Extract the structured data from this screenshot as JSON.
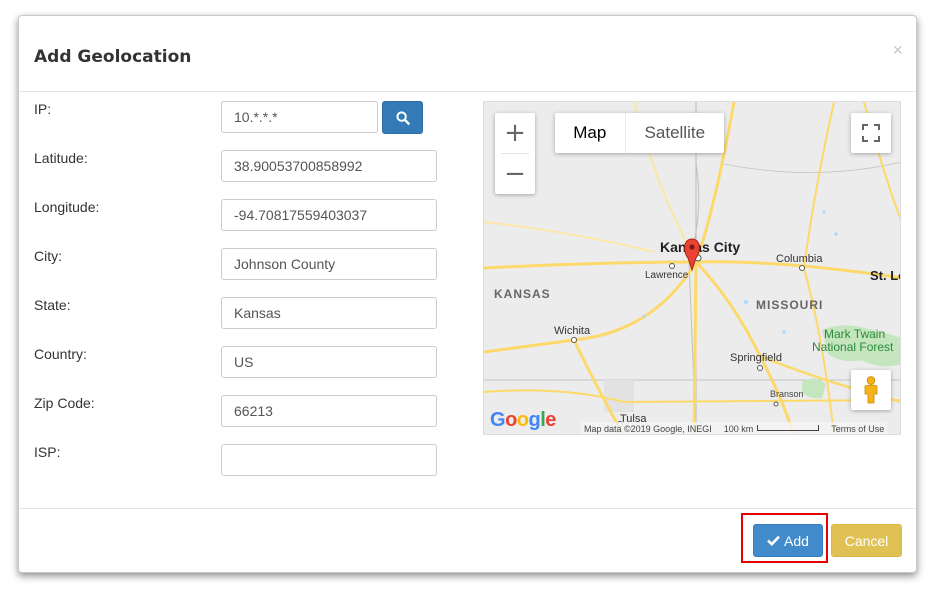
{
  "dialog": {
    "title": "Add Geolocation",
    "close_glyph": "×"
  },
  "form": {
    "ip_label": "IP:",
    "ip_value": "10.*.*.*",
    "latitude_label": "Latitude:",
    "latitude_value": "38.90053700858992",
    "longitude_label": "Longitude:",
    "longitude_value": "-94.70817559403037",
    "city_label": "City:",
    "city_value": "Johnson County",
    "state_label": "State:",
    "state_value": "Kansas",
    "country_label": "Country:",
    "country_value": "US",
    "zip_label": "Zip Code:",
    "zip_value": "66213",
    "isp_label": "ISP:",
    "isp_value": ""
  },
  "map": {
    "map_type_map": "Map",
    "map_type_satellite": "Satellite",
    "zoom_in": "+",
    "zoom_out": "−",
    "attribution": "Map data ©2019 Google, INEGI",
    "scale_label": "100 km",
    "terms": "Terms of Use",
    "labels": {
      "kansas_city": "Kansas City",
      "lawrence": "Lawrence",
      "columbia": "Columbia",
      "st_louis": "St. Lo",
      "kansas": "KANSAS",
      "missouri": "MISSOURI",
      "wichita": "Wichita",
      "springfield": "Springfield",
      "mark_twain": "Mark Twain",
      "national_forest": "National Forest",
      "branson": "Branson",
      "tulsa": "Tulsa"
    },
    "google_logo": {
      "g1": "G",
      "o1": "o",
      "o2": "o",
      "g2": "g",
      "l": "l",
      "e": "e"
    }
  },
  "footer": {
    "add_label": "Add",
    "cancel_label": "Cancel"
  },
  "colors": {
    "primary": "#428bca",
    "warning": "#e0c254",
    "highlight": "#e60000",
    "map_road": "#fdd96a",
    "map_park": "#c4e5be"
  }
}
